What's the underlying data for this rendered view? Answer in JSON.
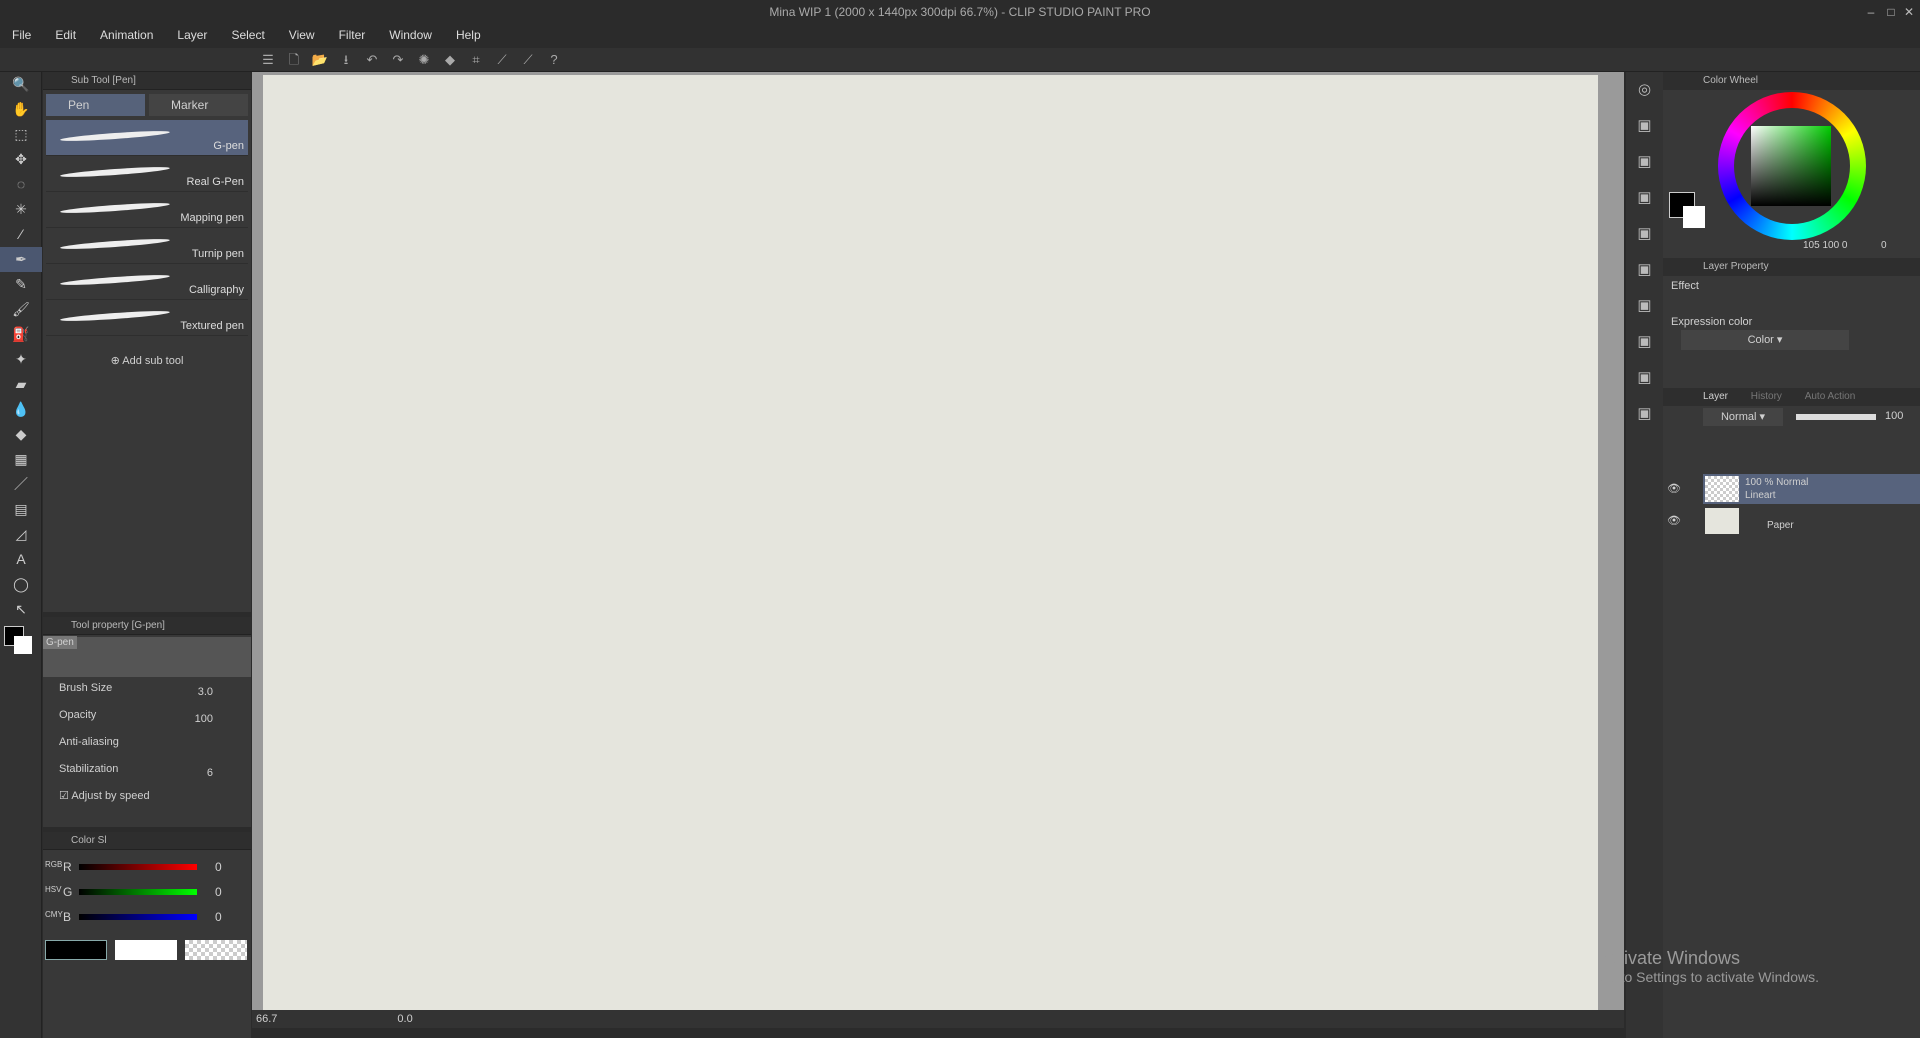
{
  "title": "Mina WIP 1 (2000 x 1440px 300dpi 66.7%) - CLIP STUDIO PAINT PRO",
  "menu": [
    "File",
    "Edit",
    "Animation",
    "Layer",
    "Select",
    "View",
    "Filter",
    "Window",
    "Help"
  ],
  "subtool": {
    "header": "Sub Tool [Pen]",
    "tabs": [
      "Pen",
      "Marker"
    ],
    "brushes": [
      "G-pen",
      "Real G-Pen",
      "Mapping pen",
      "Turnip pen",
      "Calligraphy",
      "Textured pen"
    ],
    "add": "Add sub tool"
  },
  "toolprop": {
    "header": "Tool property [G-pen]",
    "preview_label": "G-pen",
    "brush_size_label": "Brush Size",
    "brush_size": "3.0",
    "opacity_label": "Opacity",
    "opacity": "100",
    "aa_label": "Anti-aliasing",
    "stab_label": "Stabilization",
    "stab": "6",
    "adjust": "Adjust by speed"
  },
  "color_slider": {
    "header": "Color Sl",
    "r": "0",
    "g": "0",
    "b": "0",
    "r_label": "R",
    "g_label": "G",
    "b_label": "B",
    "mode_labels": [
      "RGB",
      "HSV",
      "CMY"
    ]
  },
  "status": {
    "zoom": "66.7",
    "rotation": "0.0"
  },
  "color_wheel": {
    "header": "Color Wheel",
    "values": "105 100 0",
    "extra": "0"
  },
  "layer_property": {
    "header": "Layer Property",
    "effect": "Effect",
    "expr_label": "Expression color",
    "expr_value": "Color"
  },
  "layer_panel": {
    "tabs": [
      "Layer",
      "History",
      "Auto Action"
    ],
    "blend": "Normal",
    "opacity": "100",
    "layers": [
      {
        "line1": "100 % Normal",
        "line2": "Lineart"
      },
      {
        "line1": "",
        "line2": "Paper"
      }
    ]
  },
  "watermark": {
    "line1": "Activate Windows",
    "line2": "Go to Settings to activate Windows."
  }
}
